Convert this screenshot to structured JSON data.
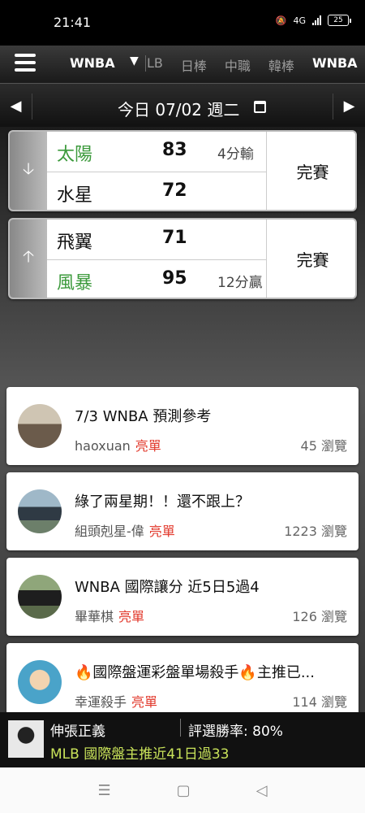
{
  "status_bar": {
    "time": "21:41",
    "battery": "25",
    "network": "4G"
  },
  "nav": {
    "current": "WNBA",
    "tabs": [
      {
        "label": "LB"
      },
      {
        "label": "日棒"
      },
      {
        "label": "中職"
      },
      {
        "label": "韓棒"
      },
      {
        "label": "WNBA"
      }
    ]
  },
  "date_bar": {
    "prev": "◀",
    "next": "▶",
    "label": "今日 07/02 週二"
  },
  "games": [
    {
      "arrow": "🡣",
      "status": "完賽",
      "teams": [
        {
          "name": "太陽",
          "score": "83",
          "note": "4分輸",
          "highlight": true
        },
        {
          "name": "水星",
          "score": "72",
          "note": "",
          "highlight": false
        }
      ]
    },
    {
      "arrow": "🡡",
      "status": "完賽",
      "teams": [
        {
          "name": "飛翼",
          "score": "71",
          "note": "",
          "highlight": false
        },
        {
          "name": "風暴",
          "score": "95",
          "note": "12分贏",
          "highlight": true
        }
      ]
    }
  ],
  "articles": [
    {
      "title": "7/3 WNBA 預測參考",
      "author": "haoxuan",
      "badge": "亮單",
      "views": "45 瀏覽",
      "avatar_color": "#6b5b4b"
    },
    {
      "title": "綠了兩星期！！還不跟上？",
      "author": "組頭剋星-偉",
      "badge": "亮單",
      "views": "1223 瀏覽",
      "avatar_color": "#4b5a6b"
    },
    {
      "title": "WNBA 國際讓分 近5日5過4",
      "author": "畢華棋",
      "badge": "亮單",
      "views": "126 瀏覽",
      "avatar_color": "#556b4b"
    },
    {
      "title": "🔥國際盤運彩盤單場殺手🔥主推已...",
      "author": "幸運殺手",
      "badge": "亮單",
      "views": "114 瀏覽",
      "avatar_color": "#4aa3c9"
    }
  ],
  "ticker": {
    "name": "伸張正義",
    "rate": "評選勝率: 80%",
    "headline": "MLB 國際盤主推近41日過33"
  },
  "sys_nav": {
    "menu": "☰",
    "home": "▢",
    "back": "◁"
  },
  "colors": {
    "win_green": "#3c9a3c",
    "badge_red": "#e23b2e",
    "ticker_green": "#c9e35a"
  }
}
